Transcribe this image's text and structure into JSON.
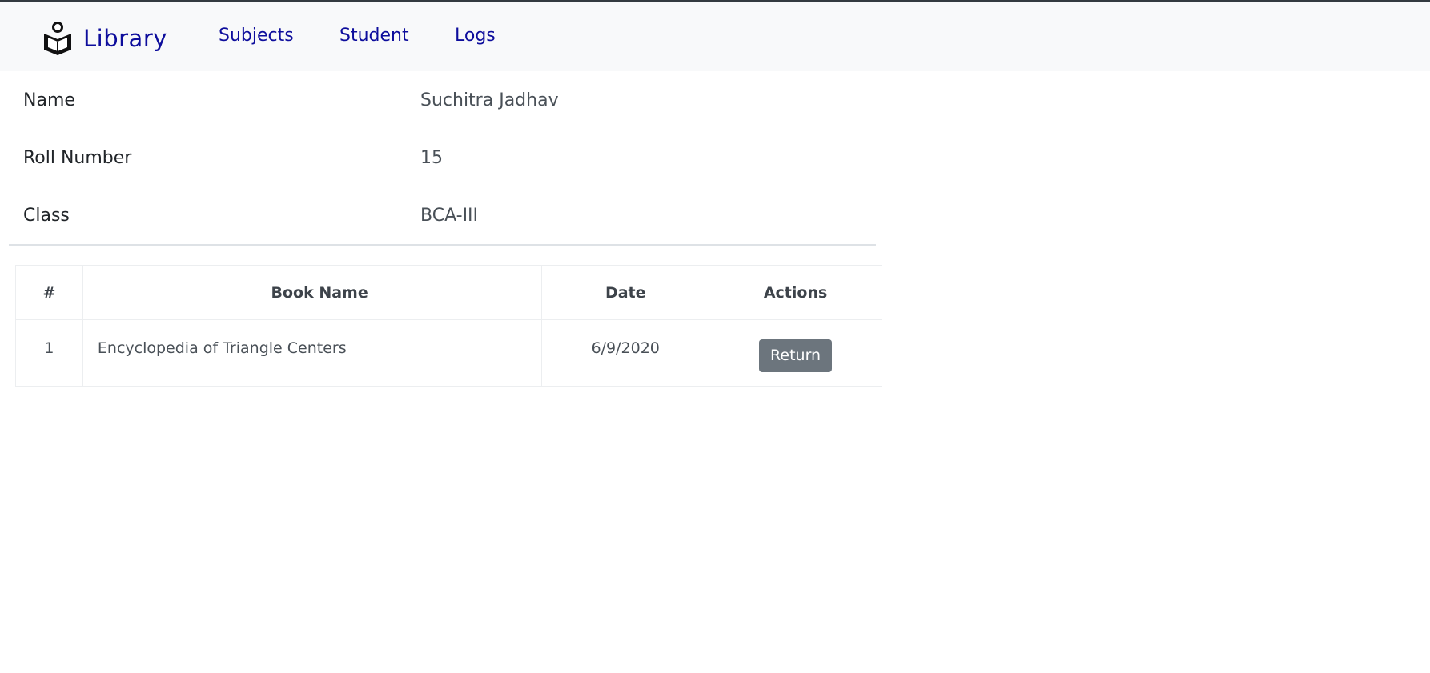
{
  "navbar": {
    "brand": "Library",
    "brand_icon": "reader-icon",
    "links": [
      "Subjects",
      "Student",
      "Logs"
    ],
    "link_color": "#0d0d9c"
  },
  "student": {
    "name_label": "Name",
    "name_value": "Suchitra Jadhav",
    "roll_label": "Roll Number",
    "roll_value": "15",
    "class_label": "Class",
    "class_value": "BCA-III"
  },
  "books_table": {
    "columns": [
      "#",
      "Book Name",
      "Date",
      "Actions"
    ],
    "rows": [
      {
        "num": "1",
        "book": "Encyclopedia of Triangle Centers",
        "date": "6/9/2020",
        "action": "Return"
      }
    ]
  },
  "colors": {
    "navbar_bg": "#f8f9fa",
    "button_bg": "#6c757d"
  }
}
